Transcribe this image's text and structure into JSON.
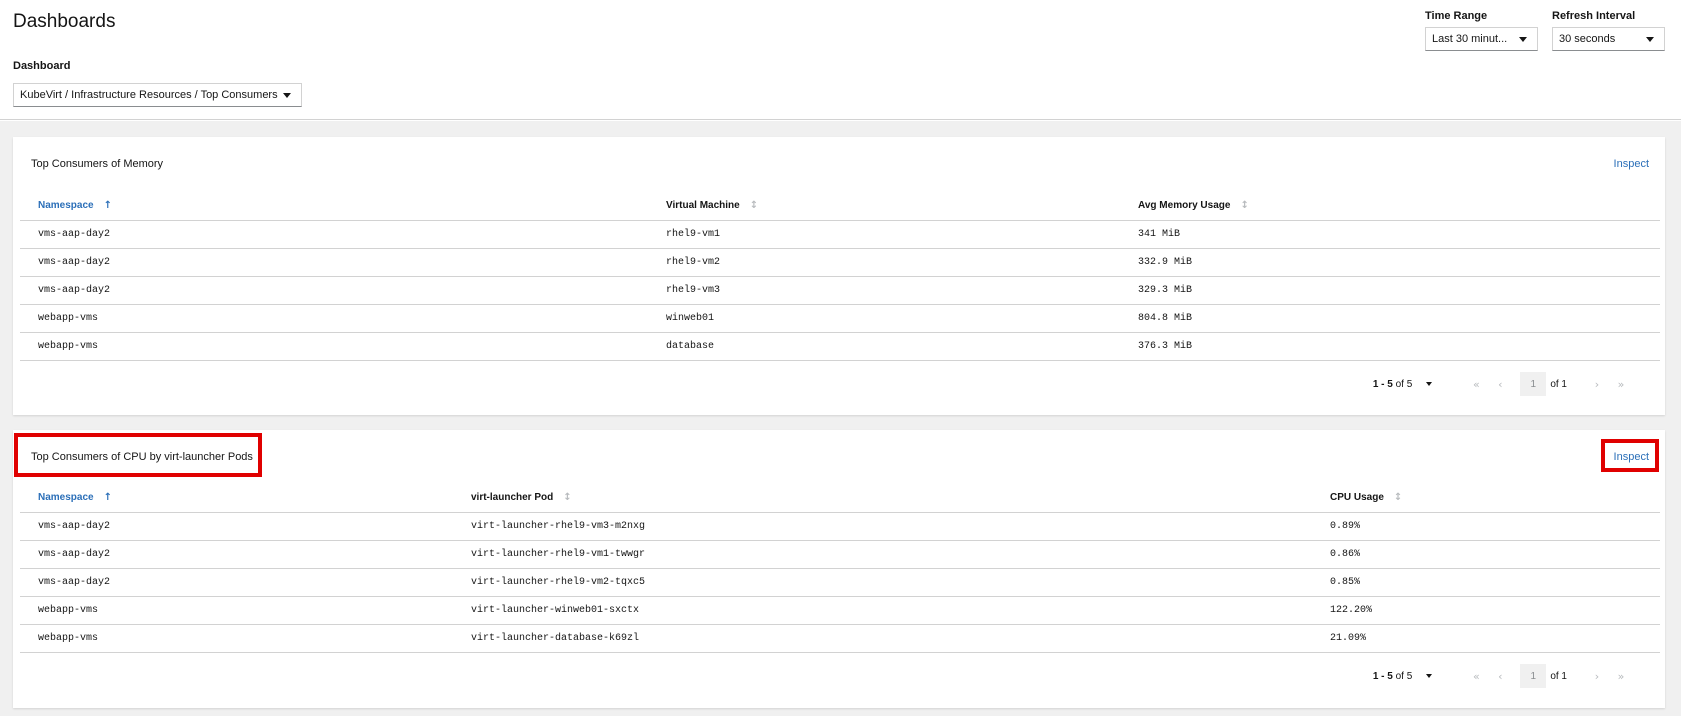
{
  "header": {
    "title": "Dashboards",
    "dashboard_label": "Dashboard",
    "dashboard_value": "KubeVirt / Infrastructure Resources / Top Consumers",
    "time_range_label": "Time Range",
    "time_range_value": "Last 30 minut...",
    "refresh_label": "Refresh Interval",
    "refresh_value": "30 seconds"
  },
  "memory_card": {
    "title": "Top Consumers of Memory",
    "inspect": "Inspect",
    "columns": [
      "Namespace",
      "Virtual Machine",
      "Avg Memory Usage"
    ],
    "sorted_column": "Namespace",
    "rows": [
      [
        "vms-aap-day2",
        "rhel9-vm1",
        "341 MiB"
      ],
      [
        "vms-aap-day2",
        "rhel9-vm2",
        "332.9 MiB"
      ],
      [
        "vms-aap-day2",
        "rhel9-vm3",
        "329.3 MiB"
      ],
      [
        "webapp-vms",
        "winweb01",
        "804.8 MiB"
      ],
      [
        "webapp-vms",
        "database",
        "376.3 MiB"
      ]
    ],
    "pagination": {
      "range": "1 - 5",
      "of_total": "of 5",
      "page": "1",
      "of_pages": "of 1"
    }
  },
  "cpu_card": {
    "title": "Top Consumers of CPU by virt-launcher Pods",
    "inspect": "Inspect",
    "columns": [
      "Namespace",
      "virt-launcher Pod",
      "CPU Usage"
    ],
    "sorted_column": "Namespace",
    "rows": [
      [
        "vms-aap-day2",
        "virt-launcher-rhel9-vm3-m2nxg",
        "0.89%"
      ],
      [
        "vms-aap-day2",
        "virt-launcher-rhel9-vm1-twwgr",
        "0.86%"
      ],
      [
        "vms-aap-day2",
        "virt-launcher-rhel9-vm2-tqxc5",
        "0.85%"
      ],
      [
        "webapp-vms",
        "virt-launcher-winweb01-sxctx",
        "122.20%"
      ],
      [
        "webapp-vms",
        "virt-launcher-database-k69zl",
        "21.09%"
      ]
    ],
    "pagination": {
      "range": "1 - 5",
      "of_total": "of 5",
      "page": "1",
      "of_pages": "of 1"
    }
  },
  "colors": {
    "link": "#2b6fb8",
    "highlight": "#e00000",
    "background": "#f0f0f0"
  },
  "icons": {
    "sort": "sort-icon",
    "sorted_asc": "sort-ascending-icon",
    "first": "first-page-icon",
    "prev": "previous-page-icon",
    "next": "next-page-icon",
    "last": "last-page-icon"
  }
}
